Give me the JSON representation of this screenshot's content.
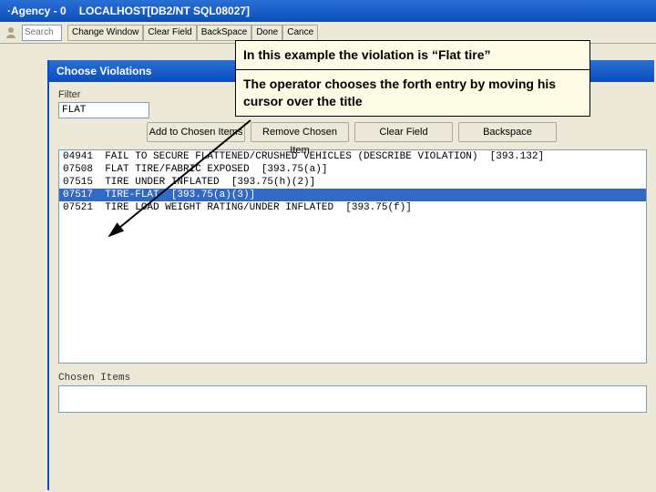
{
  "titlebar": {
    "seg1": "·Agency - 0",
    "seg2": "LOCALHOST[DB2/NT SQL08027]"
  },
  "toolbar": {
    "search_placeholder": "Search",
    "buttons": {
      "change_window": "Change Window",
      "clear_field": "Clear Field",
      "backspace": "BackSpace",
      "done": "Done",
      "cancel": "Cance"
    }
  },
  "dialog": {
    "title": "Choose Violations",
    "filter_label": "Filter",
    "filter_value": "FLAT",
    "buttons": {
      "add": "Add to Chosen Items",
      "remove": "Remove Chosen Item",
      "clear": "Clear Field",
      "backspace": "Backspace"
    },
    "list_items": [
      {
        "code": "04941",
        "text": "FAIL TO SECURE FLATTENED/CRUSHED VEHICLES (DESCRIBE VIOLATION)  [393.132]"
      },
      {
        "code": "07508",
        "text": "FLAT TIRE/FABRIC EXPOSED  [393.75(a)]"
      },
      {
        "code": "07515",
        "text": "TIRE UNDER INFLATED  [393.75(h)(2)]"
      },
      {
        "code": "07517",
        "text": "TIRE-FLAT  [393.75(a)(3)]"
      },
      {
        "code": "07521",
        "text": "TIRE LOAD WEIGHT RATING/UNDER INFLATED  [393.75(f)]"
      }
    ],
    "selected_index": 3,
    "chosen_label": "Chosen Items"
  },
  "callout": {
    "line1": "In this example the violation is “Flat tire”",
    "line2": "The operator chooses the forth entry by moving his cursor over the title"
  }
}
